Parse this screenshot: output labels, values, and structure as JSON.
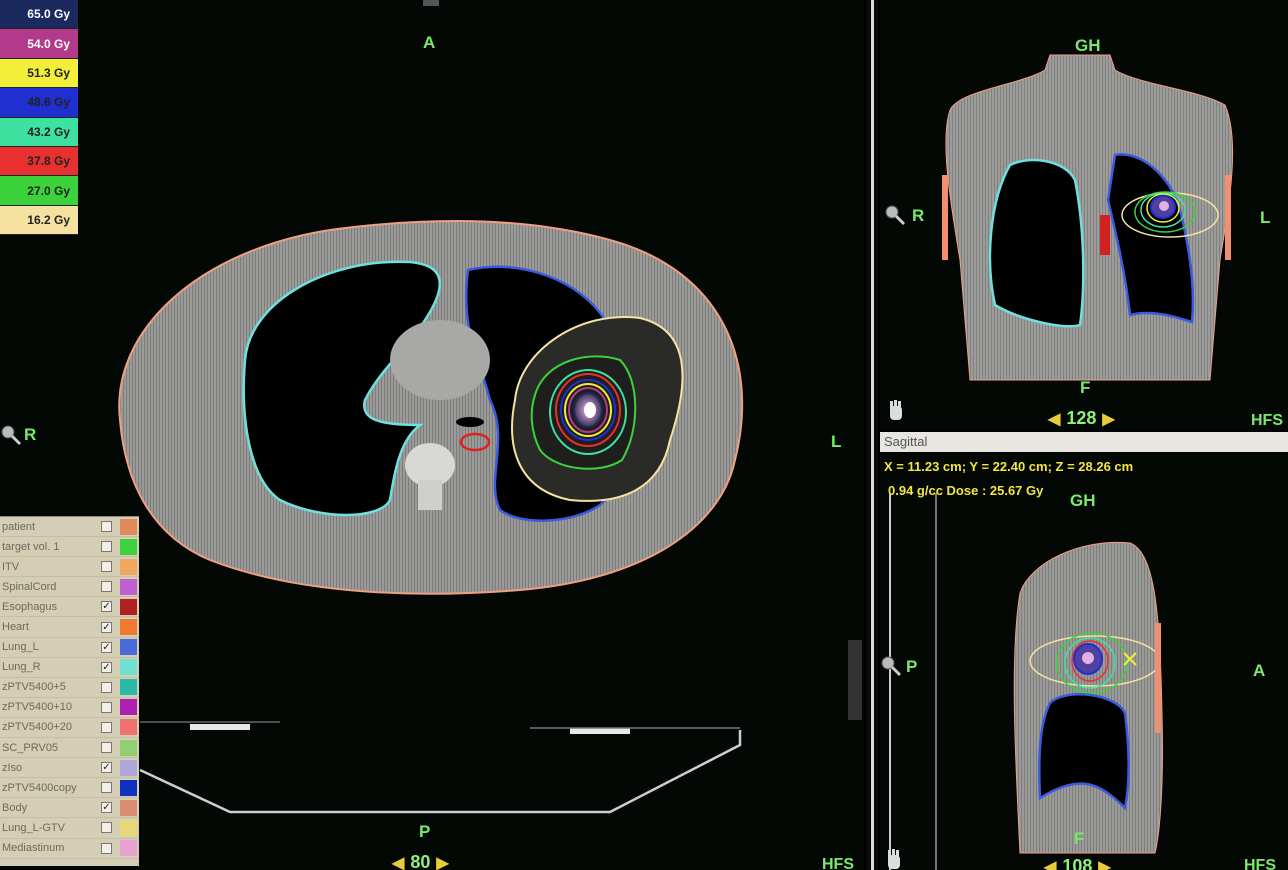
{
  "dose_legend": [
    {
      "label": "65.0 Gy",
      "color": "#1b2a5e",
      "text": "#ffffff"
    },
    {
      "label": "54.0 Gy",
      "color": "#b33a8a",
      "text": "#ffffff"
    },
    {
      "label": "51.3 Gy",
      "color": "#f2ee3a",
      "text": "#222222"
    },
    {
      "label": "48.6 Gy",
      "color": "#1f2fd0",
      "text": "#222222"
    },
    {
      "label": "43.2 Gy",
      "color": "#3ee2a0",
      "text": "#222222"
    },
    {
      "label": "37.8 Gy",
      "color": "#e83030",
      "text": "#222222"
    },
    {
      "label": "27.0 Gy",
      "color": "#3cd23c",
      "text": "#222222"
    },
    {
      "label": "16.2 Gy",
      "color": "#f5e2a0",
      "text": "#222222"
    }
  ],
  "structures": [
    {
      "name": "patient",
      "checked": false,
      "color": "#e08a5a"
    },
    {
      "name": "target vol. 1",
      "checked": false,
      "color": "#3ed23e"
    },
    {
      "name": "ITV",
      "checked": false,
      "color": "#f0a860"
    },
    {
      "name": "SpinalCord",
      "checked": false,
      "color": "#c060d0"
    },
    {
      "name": "Esophagus",
      "checked": true,
      "color": "#b02020"
    },
    {
      "name": "Heart",
      "checked": true,
      "color": "#f07a30"
    },
    {
      "name": "Lung_L",
      "checked": true,
      "color": "#4a6ad8"
    },
    {
      "name": "Lung_R",
      "checked": true,
      "color": "#70e0d0"
    },
    {
      "name": "zPTV5400+5",
      "checked": false,
      "color": "#2ab8a8"
    },
    {
      "name": "zPTV5400+10",
      "checked": false,
      "color": "#b020b0"
    },
    {
      "name": "zPTV5400+20",
      "checked": false,
      "color": "#f07070"
    },
    {
      "name": "SC_PRV05",
      "checked": false,
      "color": "#90d070"
    },
    {
      "name": "zIso",
      "checked": true,
      "color": "#b0a8d8"
    },
    {
      "name": "zPTV5400copy",
      "checked": false,
      "color": "#1030c0"
    },
    {
      "name": "Body",
      "checked": true,
      "color": "#d89070"
    },
    {
      "name": "Lung_L-GTV",
      "checked": false,
      "color": "#e8d878"
    },
    {
      "name": "Mediastinum",
      "checked": false,
      "color": "#e8a0d0"
    }
  ],
  "axial": {
    "anterior": "A",
    "posterior": "P",
    "right": "R",
    "left": "L",
    "slice": "80",
    "orientation": "HFS"
  },
  "coronal": {
    "top": "GH",
    "bottom": "F",
    "right": "R",
    "left": "L",
    "slice": "128",
    "orientation": "HFS"
  },
  "sagittal": {
    "tab": "Sagittal",
    "coords": "X = 11.23 cm; Y = 22.40 cm; Z = 28.26 cm",
    "density_dose": "0.94 g/cc Dose :  25.67 Gy",
    "top": "GH",
    "bottom": "F",
    "posterior": "P",
    "anterior": "A",
    "slice": "108",
    "orientation": "HFS"
  },
  "icons": [
    "zoom-icon",
    "pan-hand-icon",
    "slice-arrow-icon"
  ]
}
